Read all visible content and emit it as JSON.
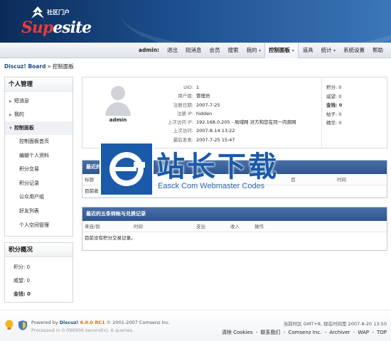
{
  "header": {
    "logo_small_text": "社区门户",
    "logo_brand_sup": "Sup",
    "logo_brand_site": "esite"
  },
  "menu": {
    "username": "admin:",
    "items": [
      "退出",
      "短消息",
      "会员",
      "搜索",
      "我的",
      "控制面板",
      "道具",
      "统计",
      "系统设置",
      "帮助"
    ],
    "active": "控制面板"
  },
  "breadcrumb": {
    "home": "Discuz! Board",
    "separator": "»",
    "current": "控制面板"
  },
  "sidebar": {
    "title": "个人管理",
    "nav": [
      "短消息",
      "我的",
      "控制面板"
    ],
    "current": "控制面板",
    "sub": [
      "控制面板首页",
      "编辑个人资料",
      "积分交易",
      "积分记录",
      "公众用户组",
      "好友列表",
      "个人空间管理"
    ]
  },
  "credits_summary": {
    "title": "积分概况",
    "items": [
      {
        "label": "积分:",
        "value": "0"
      },
      {
        "label": "威望:",
        "value": "0"
      },
      {
        "label": "金钱:",
        "value": "0"
      }
    ]
  },
  "profile": {
    "username": "admin",
    "rows": [
      {
        "k": "UID:",
        "v": "1"
      },
      {
        "k": "用户组:",
        "v": "管理员"
      },
      {
        "k": "注册日期:",
        "v": "2007-7-25"
      },
      {
        "k": "注册 IP:",
        "v": "hidden"
      },
      {
        "k": "上次访问 IP:",
        "v": "192.168.0.205 - 局域网 对方和您在同一内部网"
      },
      {
        "k": "上次访问:",
        "v": "2007-8-14 13:22"
      },
      {
        "k": "最后发表:",
        "v": "2007-7-25 15:47"
      }
    ],
    "stats": [
      {
        "label": "积分:",
        "value": "0"
      },
      {
        "label": "威望:",
        "value": "0"
      },
      {
        "label": "金钱:",
        "value": "0"
      },
      {
        "label": "帖子:",
        "value": "0"
      },
      {
        "label": "精华:",
        "value": "0"
      }
    ]
  },
  "latest_panel": {
    "title": "最近的",
    "col_title": "标题",
    "col_right1": "目",
    "col_right2": "时间",
    "empty": "目前收"
  },
  "exchange_panel": {
    "title": "最近的五条转帐与兑换记录",
    "cols": [
      "来自/到",
      "时间",
      "支出",
      "收入",
      "操作"
    ],
    "empty": "目前没有积分交易记录。"
  },
  "watermark": {
    "title": "站长下载",
    "subtitle": "Easck Com Webmaster Codes"
  },
  "footer": {
    "powered_prefix": "Powered by",
    "brand": "Discuz!",
    "version": "6.0.0 RC1",
    "copyright": "© 2001-2007 Comsenz Inc.",
    "processed": "Processed in 0.096906 second(s), 6 queries.",
    "time_info": "当前时区  GMT+8, 现在时间是  2007-8-20 13:50",
    "links": [
      "清除 Cookies",
      "联系我们",
      "Comsenz Inc.",
      "Archiver",
      "WAP",
      "TOP"
    ],
    "link_separator": "-"
  },
  "colors": {
    "header_dark": "#0b2c5a",
    "header_light": "#3c77b8",
    "panel_header": "#2f5590",
    "brand_red": "#e83b3b",
    "watermark_blue": "#1a5aa8"
  },
  "icons": {
    "logo_mark": "supesite-logo-icon",
    "avatar": "user-silhouette-icon",
    "watermark_logo": "easck-logo-icon",
    "footer_bulb": "lightbulb-icon",
    "footer_shield": "shield-icon"
  }
}
